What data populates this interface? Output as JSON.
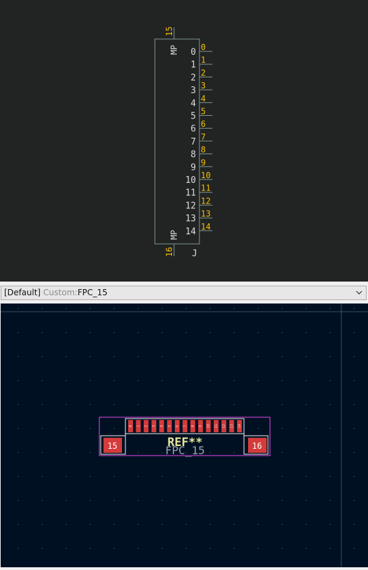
{
  "symbol": {
    "reference": "J",
    "mount_pins": [
      {
        "name": "MP",
        "number": "15"
      },
      {
        "name": "MP",
        "number": "16"
      }
    ],
    "pins": [
      {
        "name": "0",
        "number": "0"
      },
      {
        "name": "1",
        "number": "1"
      },
      {
        "name": "2",
        "number": "2"
      },
      {
        "name": "3",
        "number": "3"
      },
      {
        "name": "4",
        "number": "4"
      },
      {
        "name": "5",
        "number": "5"
      },
      {
        "name": "6",
        "number": "6"
      },
      {
        "name": "7",
        "number": "7"
      },
      {
        "name": "8",
        "number": "8"
      },
      {
        "name": "9",
        "number": "9"
      },
      {
        "name": "10",
        "number": "10"
      },
      {
        "name": "11",
        "number": "11"
      },
      {
        "name": "12",
        "number": "12"
      },
      {
        "name": "13",
        "number": "13"
      },
      {
        "name": "14",
        "number": "14"
      }
    ]
  },
  "footprint_selector": {
    "prefix": "[Default]",
    "library": "Custom:",
    "name": "FPC_15"
  },
  "footprint": {
    "reference": "REF**",
    "value": "FPC_15",
    "mount_pads": [
      "15",
      "16"
    ],
    "signal_pads": [
      "0",
      "1",
      "2",
      "3",
      "4",
      "5",
      "6",
      "7",
      "8",
      "9",
      "10",
      "11",
      "12",
      "13",
      "14"
    ]
  },
  "colors": {
    "symbol_background": "#222323",
    "symbol_body": "#7c9b95",
    "pin_number": "#f2c100",
    "pin_name": "#dcdcdc",
    "pcb_background": "#001023",
    "pad": "#d43b3b",
    "courtyard": "#e84ce8",
    "silkscreen": "#f2f2f2",
    "reference": "#e8e89a",
    "value": "#9aa2a8"
  }
}
